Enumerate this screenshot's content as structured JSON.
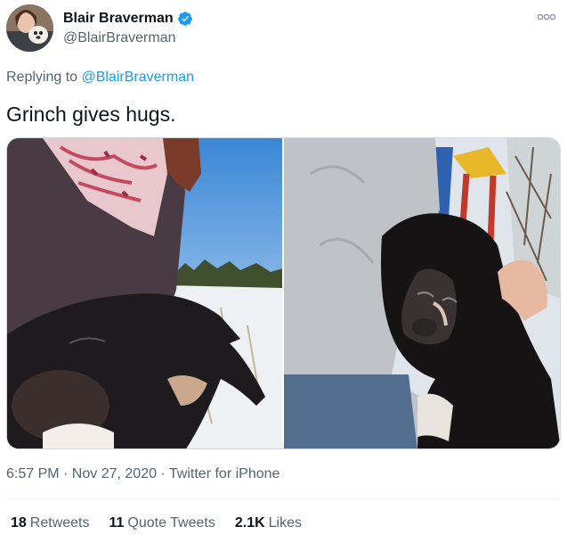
{
  "tweet": {
    "author": {
      "display_name": "Blair Braverman",
      "handle": "@BlairBraverman",
      "verified": true,
      "avatar_icon": "profile-avatar"
    },
    "more_icon": "more-options-icon",
    "reply_context": {
      "prefix": "Replying to",
      "mention": "@BlairBraverman"
    },
    "text": "Grinch gives hugs.",
    "media": [
      {
        "description_icon": "photo-dog-hug-left"
      },
      {
        "description_icon": "photo-dog-hug-right"
      }
    ],
    "meta": {
      "timestamp": "6:57 PM · Nov 27, 2020 · Twitter for iPhone"
    },
    "stats": [
      {
        "count": "18",
        "label": "Retweets"
      },
      {
        "count": "11",
        "label": "Quote Tweets"
      },
      {
        "count": "2.1K",
        "label": "Likes"
      }
    ],
    "colors": {
      "accent": "#1d9bf0",
      "secondary_text": "#536471",
      "primary_text": "#0f1419"
    }
  }
}
